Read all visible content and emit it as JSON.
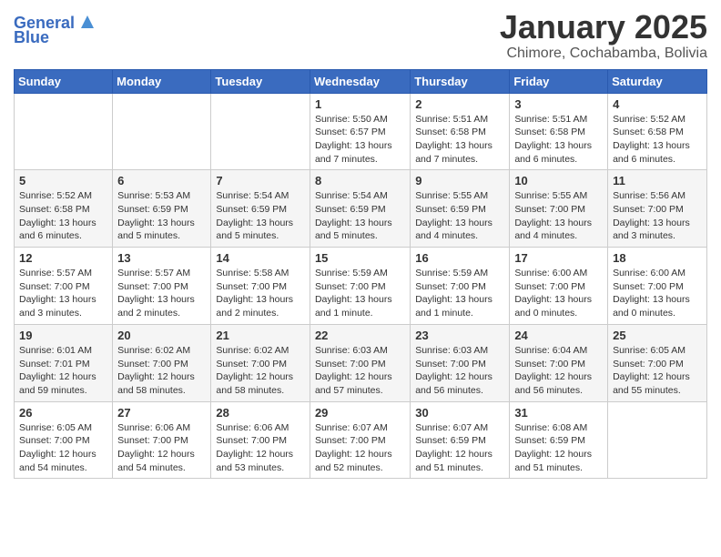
{
  "logo": {
    "line1": "General",
    "line2": "Blue"
  },
  "title": "January 2025",
  "location": "Chimore, Cochabamba, Bolivia",
  "days_of_week": [
    "Sunday",
    "Monday",
    "Tuesday",
    "Wednesday",
    "Thursday",
    "Friday",
    "Saturday"
  ],
  "weeks": [
    [
      {
        "day": "",
        "info": ""
      },
      {
        "day": "",
        "info": ""
      },
      {
        "day": "",
        "info": ""
      },
      {
        "day": "1",
        "info": "Sunrise: 5:50 AM\nSunset: 6:57 PM\nDaylight: 13 hours and 7 minutes."
      },
      {
        "day": "2",
        "info": "Sunrise: 5:51 AM\nSunset: 6:58 PM\nDaylight: 13 hours and 7 minutes."
      },
      {
        "day": "3",
        "info": "Sunrise: 5:51 AM\nSunset: 6:58 PM\nDaylight: 13 hours and 6 minutes."
      },
      {
        "day": "4",
        "info": "Sunrise: 5:52 AM\nSunset: 6:58 PM\nDaylight: 13 hours and 6 minutes."
      }
    ],
    [
      {
        "day": "5",
        "info": "Sunrise: 5:52 AM\nSunset: 6:58 PM\nDaylight: 13 hours and 6 minutes."
      },
      {
        "day": "6",
        "info": "Sunrise: 5:53 AM\nSunset: 6:59 PM\nDaylight: 13 hours and 5 minutes."
      },
      {
        "day": "7",
        "info": "Sunrise: 5:54 AM\nSunset: 6:59 PM\nDaylight: 13 hours and 5 minutes."
      },
      {
        "day": "8",
        "info": "Sunrise: 5:54 AM\nSunset: 6:59 PM\nDaylight: 13 hours and 5 minutes."
      },
      {
        "day": "9",
        "info": "Sunrise: 5:55 AM\nSunset: 6:59 PM\nDaylight: 13 hours and 4 minutes."
      },
      {
        "day": "10",
        "info": "Sunrise: 5:55 AM\nSunset: 7:00 PM\nDaylight: 13 hours and 4 minutes."
      },
      {
        "day": "11",
        "info": "Sunrise: 5:56 AM\nSunset: 7:00 PM\nDaylight: 13 hours and 3 minutes."
      }
    ],
    [
      {
        "day": "12",
        "info": "Sunrise: 5:57 AM\nSunset: 7:00 PM\nDaylight: 13 hours and 3 minutes."
      },
      {
        "day": "13",
        "info": "Sunrise: 5:57 AM\nSunset: 7:00 PM\nDaylight: 13 hours and 2 minutes."
      },
      {
        "day": "14",
        "info": "Sunrise: 5:58 AM\nSunset: 7:00 PM\nDaylight: 13 hours and 2 minutes."
      },
      {
        "day": "15",
        "info": "Sunrise: 5:59 AM\nSunset: 7:00 PM\nDaylight: 13 hours and 1 minute."
      },
      {
        "day": "16",
        "info": "Sunrise: 5:59 AM\nSunset: 7:00 PM\nDaylight: 13 hours and 1 minute."
      },
      {
        "day": "17",
        "info": "Sunrise: 6:00 AM\nSunset: 7:00 PM\nDaylight: 13 hours and 0 minutes."
      },
      {
        "day": "18",
        "info": "Sunrise: 6:00 AM\nSunset: 7:00 PM\nDaylight: 13 hours and 0 minutes."
      }
    ],
    [
      {
        "day": "19",
        "info": "Sunrise: 6:01 AM\nSunset: 7:01 PM\nDaylight: 12 hours and 59 minutes."
      },
      {
        "day": "20",
        "info": "Sunrise: 6:02 AM\nSunset: 7:00 PM\nDaylight: 12 hours and 58 minutes."
      },
      {
        "day": "21",
        "info": "Sunrise: 6:02 AM\nSunset: 7:00 PM\nDaylight: 12 hours and 58 minutes."
      },
      {
        "day": "22",
        "info": "Sunrise: 6:03 AM\nSunset: 7:00 PM\nDaylight: 12 hours and 57 minutes."
      },
      {
        "day": "23",
        "info": "Sunrise: 6:03 AM\nSunset: 7:00 PM\nDaylight: 12 hours and 56 minutes."
      },
      {
        "day": "24",
        "info": "Sunrise: 6:04 AM\nSunset: 7:00 PM\nDaylight: 12 hours and 56 minutes."
      },
      {
        "day": "25",
        "info": "Sunrise: 6:05 AM\nSunset: 7:00 PM\nDaylight: 12 hours and 55 minutes."
      }
    ],
    [
      {
        "day": "26",
        "info": "Sunrise: 6:05 AM\nSunset: 7:00 PM\nDaylight: 12 hours and 54 minutes."
      },
      {
        "day": "27",
        "info": "Sunrise: 6:06 AM\nSunset: 7:00 PM\nDaylight: 12 hours and 54 minutes."
      },
      {
        "day": "28",
        "info": "Sunrise: 6:06 AM\nSunset: 7:00 PM\nDaylight: 12 hours and 53 minutes."
      },
      {
        "day": "29",
        "info": "Sunrise: 6:07 AM\nSunset: 7:00 PM\nDaylight: 12 hours and 52 minutes."
      },
      {
        "day": "30",
        "info": "Sunrise: 6:07 AM\nSunset: 6:59 PM\nDaylight: 12 hours and 51 minutes."
      },
      {
        "day": "31",
        "info": "Sunrise: 6:08 AM\nSunset: 6:59 PM\nDaylight: 12 hours and 51 minutes."
      },
      {
        "day": "",
        "info": ""
      }
    ]
  ]
}
